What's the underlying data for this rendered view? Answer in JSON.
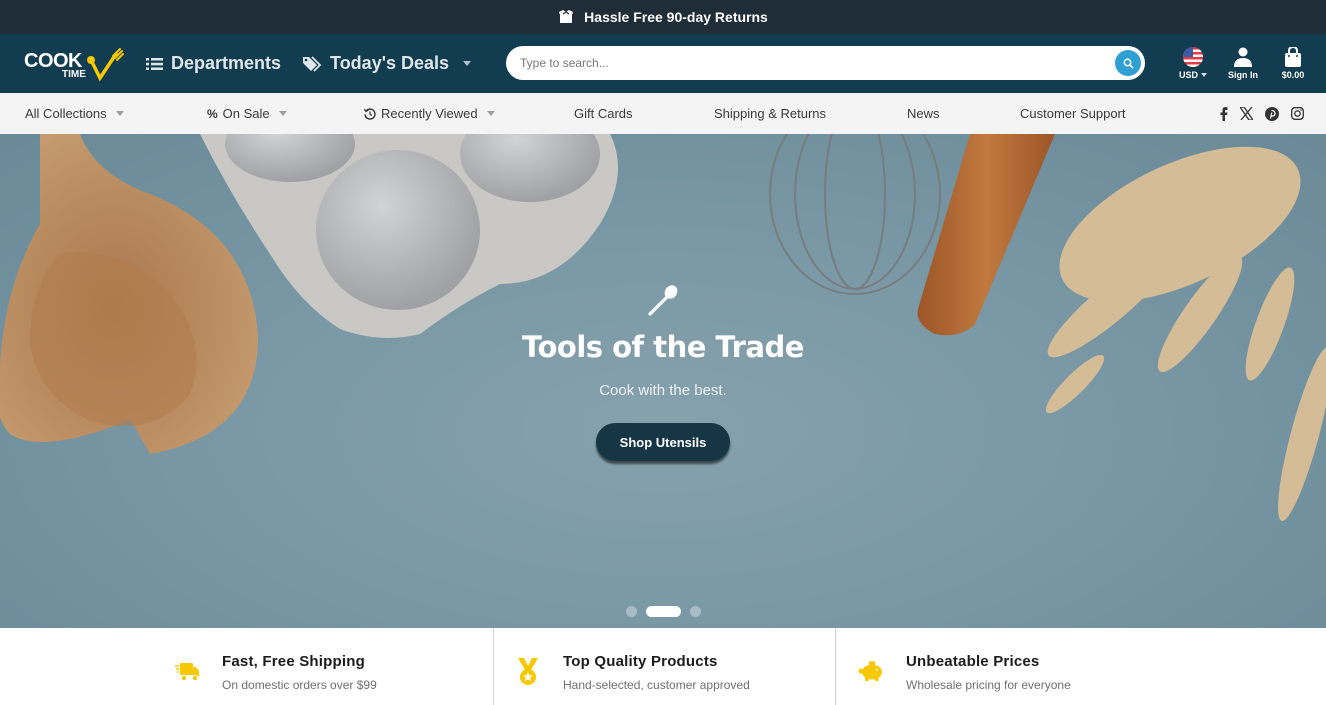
{
  "announcement": {
    "icon": "box-open-icon",
    "text": "Hassle Free 90-day Returns"
  },
  "header": {
    "logo": {
      "main": "COOK",
      "sub": "TIME"
    },
    "nav": [
      {
        "label": "Departments",
        "icon": "list-icon"
      },
      {
        "label": "Today's Deals",
        "icon": "tags-icon",
        "dropdown": true
      }
    ],
    "search": {
      "placeholder": "Type to search...",
      "value": ""
    },
    "currency": {
      "label": "USD",
      "icon": "us-flag-icon"
    },
    "account": {
      "label": "Sign In",
      "icon": "user-icon"
    },
    "cart": {
      "label": "$0.00",
      "icon": "shopping-bag-icon"
    }
  },
  "subnav": {
    "items": [
      {
        "label": "All Collections",
        "dropdown": true
      },
      {
        "label": "On Sale",
        "icon": "percent-icon",
        "dropdown": true
      },
      {
        "label": "Recently Viewed",
        "icon": "history-icon",
        "dropdown": true
      },
      {
        "label": "Gift Cards"
      },
      {
        "label": "Shipping & Returns"
      },
      {
        "label": "News"
      },
      {
        "label": "Customer Support"
      }
    ],
    "social": [
      "facebook-icon",
      "x-twitter-icon",
      "pinterest-icon",
      "instagram-icon"
    ]
  },
  "hero": {
    "icon": "spoon-icon",
    "title": "Tools of the Trade",
    "subtitle": "Cook with the best.",
    "button": "Shop Utensils",
    "slides": 3,
    "active_slide": 2,
    "highlight_color": "#c8b94a"
  },
  "features": [
    {
      "icon": "shipping-truck-icon",
      "title": "Fast, Free Shipping",
      "subtitle": "On domestic orders over $99"
    },
    {
      "icon": "medal-icon",
      "title": "Top Quality Products",
      "subtitle": "Hand-selected, customer approved"
    },
    {
      "icon": "piggy-bank-icon",
      "title": "Unbeatable Prices",
      "subtitle": "Wholesale pricing for everyone"
    }
  ],
  "colors": {
    "announcement_bg": "#1e2d38",
    "header_bg": "#123c50",
    "accent_yellow": "#f5c800",
    "search_button": "#2f9fd4",
    "hero_button_bg": "#163645"
  }
}
